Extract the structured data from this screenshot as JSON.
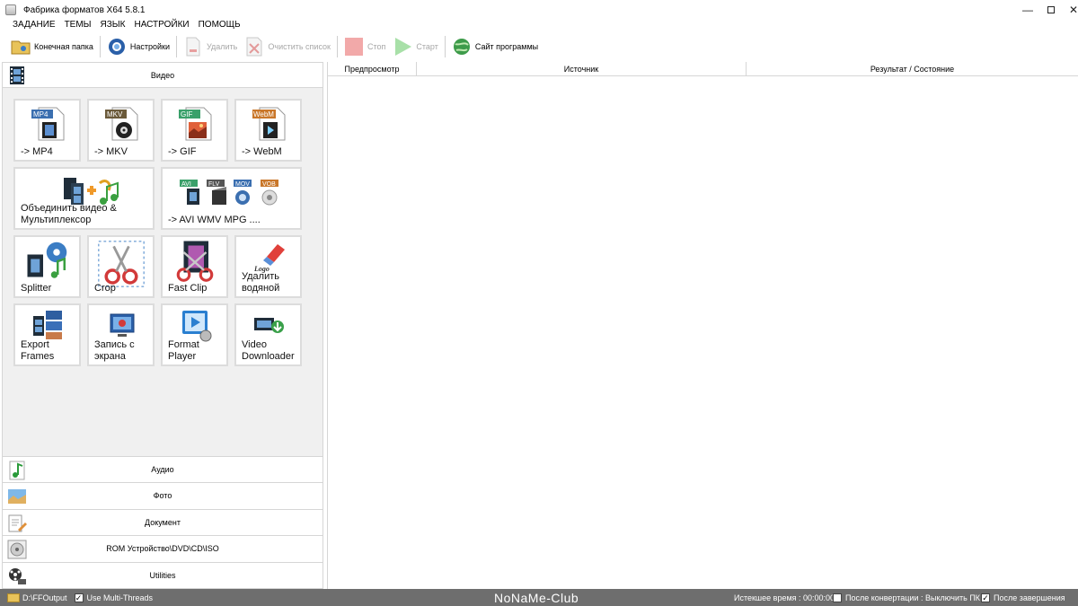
{
  "window": {
    "title": "Фабрика форматов X64 5.8.1",
    "controls": [
      "—",
      "",
      "✕"
    ]
  },
  "menu": [
    "ЗАДАНИЕ",
    "ТЕМЫ",
    "ЯЗЫК",
    "НАСТРОЙКИ",
    "ПОМОЩЬ"
  ],
  "toolbar": {
    "output_folder": "Конечная папка",
    "settings": "Настройки",
    "delete": "Удалить",
    "clear_list": "Очистить список",
    "stop": "Стоп",
    "start": "Старт",
    "website": "Сайт программы"
  },
  "left": {
    "video_header": "Видео",
    "tiles": [
      {
        "label": "-> MP4",
        "badge": "MP4",
        "badge_color": "#3b6fb0"
      },
      {
        "label": "-> MKV",
        "badge": "MKV",
        "badge_color": "#6b5a3a"
      },
      {
        "label": "-> GIF",
        "badge": "GIF",
        "badge_color": "#3aa06a"
      },
      {
        "label": "-> WebM",
        "badge": "WebM",
        "badge_color": "#c9772a"
      },
      {
        "label": "Объединить видео &\nМультиплексор"
      },
      {
        "label": "-> AVI WMV MPG ....",
        "badges": [
          "AVI",
          "FLV",
          "MOV",
          "VOB"
        ]
      },
      {
        "label": "Splitter"
      },
      {
        "label": "Crop"
      },
      {
        "label": "Fast Clip"
      },
      {
        "label": "Удалить\nводяной",
        "logo_text": "Logo"
      },
      {
        "label": "Export\nFrames"
      },
      {
        "label": "Запись с\nэкрана"
      },
      {
        "label": "Format\nPlayer"
      },
      {
        "label": "Video\nDownloader"
      }
    ],
    "categories": [
      "Аудио",
      "Фото",
      "Документ",
      "ROM Устройство\\DVD\\CD\\ISO",
      "Utilities"
    ]
  },
  "list": {
    "columns": [
      "Предпросмотр",
      "Источник",
      "Результат / Состояние"
    ]
  },
  "status": {
    "output_path": "D:\\FFOutput",
    "multithreads": "Use Multi-Threads",
    "multithreads_checked": true,
    "watermark": "NoNaMe-Club",
    "elapsed_label": "Истекшее время : 00:00:00",
    "after_convert": "После конвертации : Выключить ПК",
    "after_convert_checked": false,
    "on_finish": "После завершения",
    "on_finish_checked": true
  }
}
